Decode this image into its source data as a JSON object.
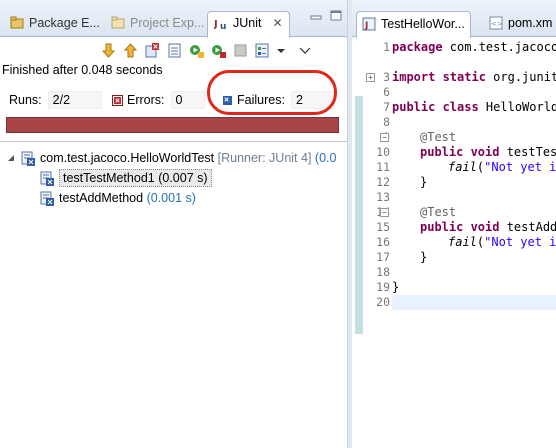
{
  "left_tabs": [
    {
      "label": "Package E...",
      "icon": "package-explorer-icon",
      "dim": false
    },
    {
      "label": "Project Exp...",
      "icon": "project-explorer-icon",
      "dim": true
    },
    {
      "label": "JUnit",
      "icon": "junit-icon",
      "active": true,
      "close": "✕"
    }
  ],
  "status": "Finished after 0.048 seconds",
  "counters": {
    "runs_label": "Runs:",
    "runs_value": "2/2",
    "errors_label": "Errors:",
    "errors_value": "0",
    "failures_label": "Failures:",
    "failures_value": "2"
  },
  "colors": {
    "progress": "#a94448",
    "highlight": "#e0261d",
    "runner": "#6d7f93",
    "time": "#2a6fb5"
  },
  "tree": {
    "root": {
      "name": "com.test.jacoco.HelloWorldTest",
      "runner": "[Runner: JUnit 4]",
      "time": "(0.0"
    },
    "children": [
      {
        "name": "testTestMethod1",
        "time": "(0.007 s)"
      },
      {
        "name": "testAddMethod",
        "time": "(0.001 s)"
      }
    ]
  },
  "right_tabs": [
    {
      "label": "TestHelloWor...",
      "icon": "java-file-icon"
    },
    {
      "label": "pom.xm",
      "icon": "xml-file-icon"
    }
  ],
  "line_numbers": [
    "1",
    "3",
    "6",
    "7",
    "8",
    "9",
    "10",
    "11",
    "12",
    "13",
    "14",
    "15",
    "16",
    "17",
    "18",
    "19",
    "20"
  ],
  "code": {
    "l1_kw": "package",
    "l1_rest": " com.test.jacoco;",
    "l3_kw": "import static",
    "l3_rest": " org.junit.",
    "l7_kw": "public class",
    "l7_rest": " HelloWorldT",
    "l9_ann": "@Test",
    "l10_kw": "public void",
    "l10_rest": " testTest",
    "l11_fn": "fail",
    "l11_p": "(",
    "l11_str": "\"Not yet i",
    "l12": "}",
    "l14_ann": "@Test",
    "l15_kw": "public void",
    "l15_rest": " testAddM",
    "l16_fn": "fail",
    "l16_p": "(",
    "l16_str": "\"Not yet i",
    "l17": "}",
    "l19": "}"
  }
}
